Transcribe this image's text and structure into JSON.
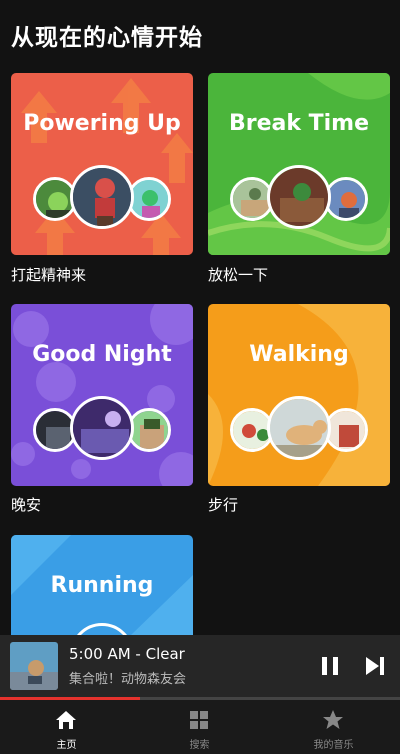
{
  "header": {
    "title": "从现在的心情开始"
  },
  "cards": [
    {
      "title": "Powering Up",
      "label": "打起精神来",
      "color": "#ec5f49"
    },
    {
      "title": "Break Time",
      "label": "放松一下",
      "color": "#4bb53b"
    },
    {
      "title": "Good Night",
      "label": "晚安",
      "color": "#7a4fd8"
    },
    {
      "title": "Walking",
      "label": "步行",
      "color": "#f59d1a"
    },
    {
      "title": "Running",
      "label": "",
      "color": "#3a9ee6"
    }
  ],
  "player": {
    "title": "5:00 AM - Clear",
    "subtitle": "集合啦！动物森友会",
    "progress": 0.35
  },
  "tabs": [
    {
      "label": "主页",
      "icon": "home-icon",
      "active": true
    },
    {
      "label": "搜索",
      "icon": "grid-icon",
      "active": false
    },
    {
      "label": "我的音乐",
      "icon": "star-icon",
      "active": false
    }
  ],
  "colors": {
    "accent": "#e5322d",
    "background": "#121212"
  }
}
